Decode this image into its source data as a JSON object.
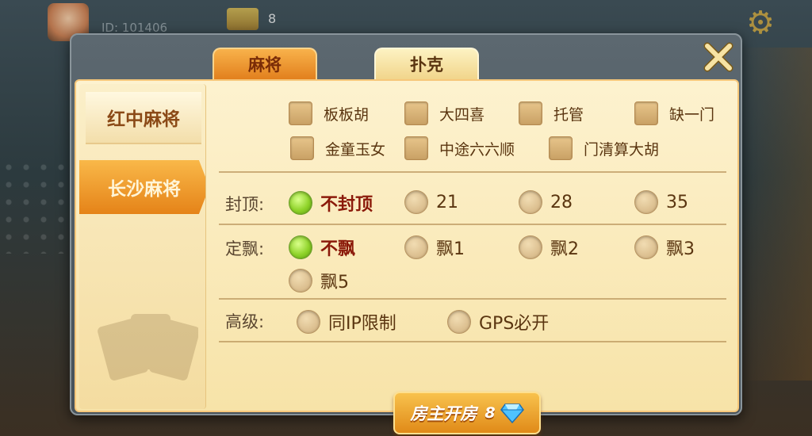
{
  "background": {
    "player_id": "ID: 101406",
    "coin_count": "8"
  },
  "tabs": [
    {
      "label": "麻将",
      "active": true
    },
    {
      "label": "扑克",
      "active": false
    }
  ],
  "game_types": [
    {
      "label": "红中麻将",
      "selected": false
    },
    {
      "label": "长沙麻将",
      "selected": true
    }
  ],
  "rules": {
    "checkboxes": [
      "板板胡",
      "大四喜",
      "托管",
      "缺一门",
      "金童玉女",
      "中途六六顺",
      "门清算大胡"
    ]
  },
  "cap": {
    "label": "封顶:",
    "options": [
      "不封顶",
      "21",
      "28",
      "35"
    ],
    "selected": "不封顶"
  },
  "piao": {
    "label": "定飘:",
    "options": [
      "不飘",
      "飘1",
      "飘2",
      "飘3",
      "飘5"
    ],
    "selected": "不飘"
  },
  "advanced": {
    "label": "高级:",
    "options": [
      "同IP限制",
      "GPS必开"
    ]
  },
  "create_button": {
    "label": "房主开房",
    "cost": "8"
  },
  "colors": {
    "accent_orange": "#e58318",
    "selected_green": "#8fd32a",
    "panel_bg": "#fdf2cf"
  }
}
